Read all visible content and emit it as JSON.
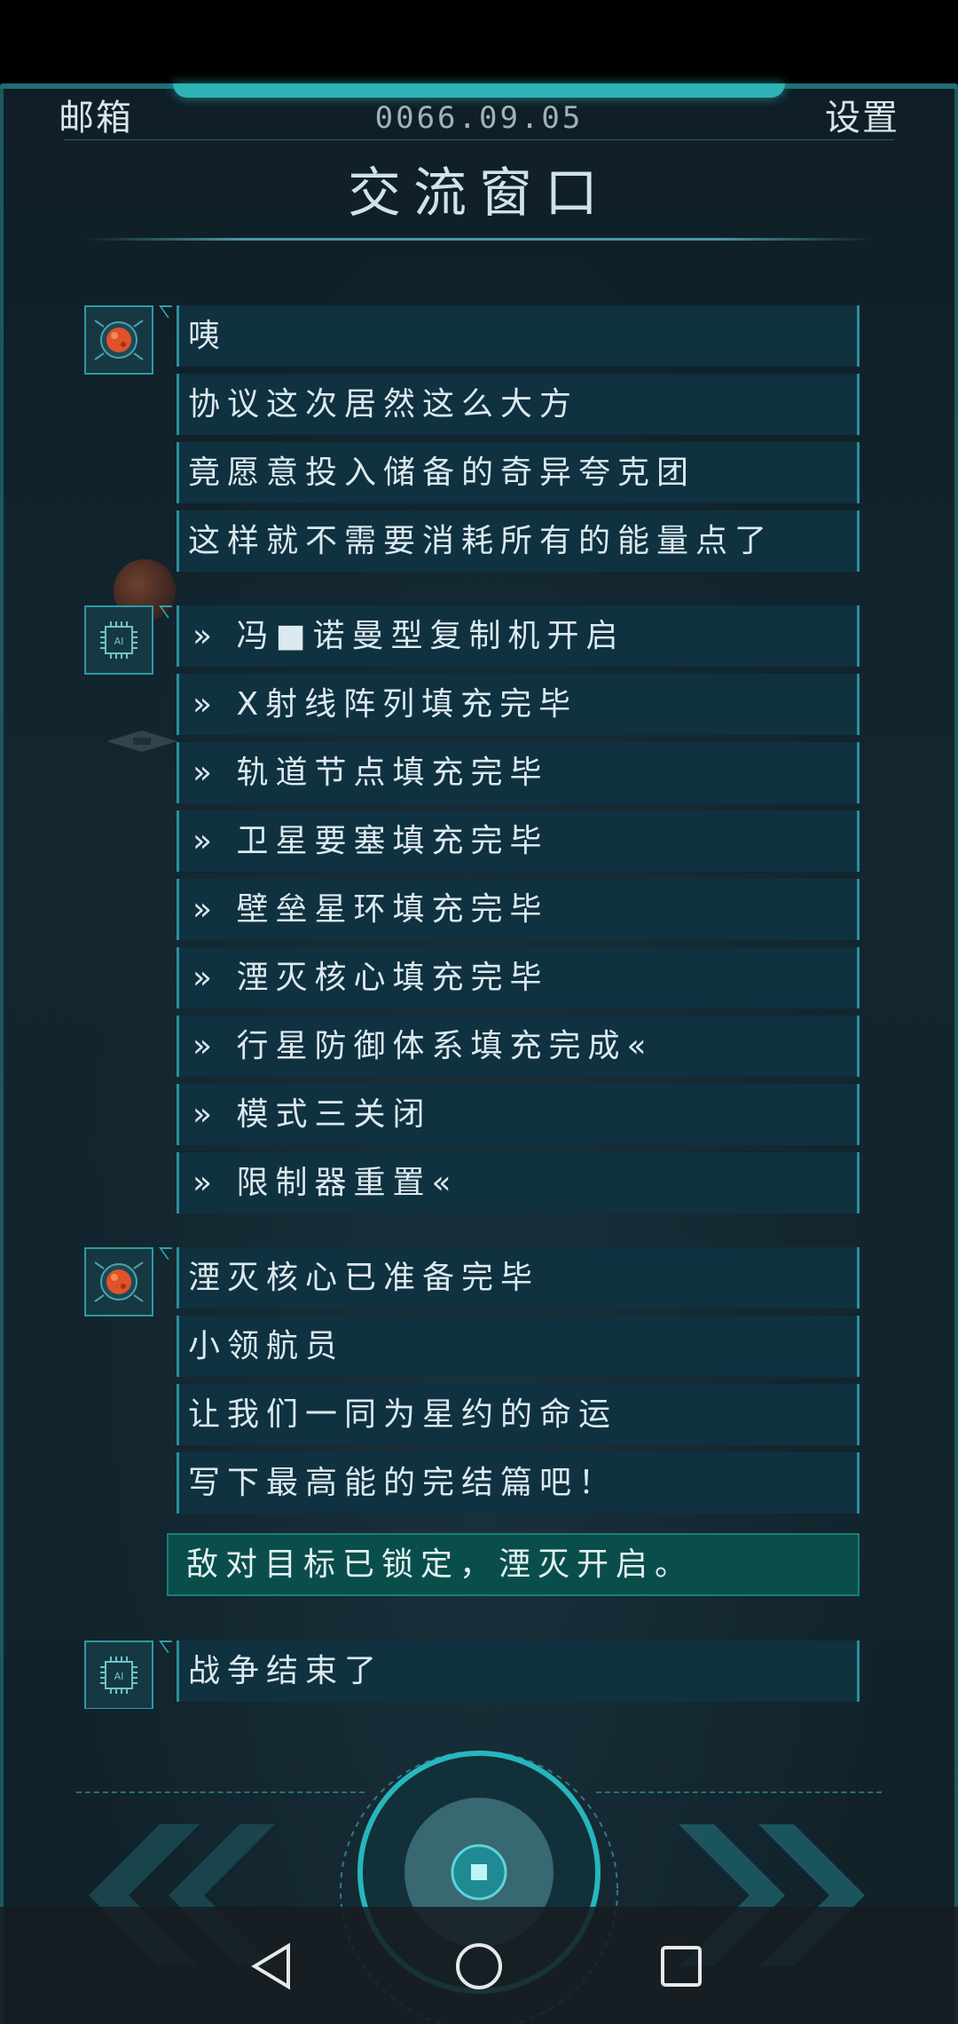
{
  "header": {
    "left_label": "邮箱",
    "date": "0066.09.05",
    "right_label": "设置",
    "title": "交流窗口"
  },
  "chat": {
    "group1": {
      "speaker": "planet-avatar",
      "messages": [
        "咦",
        "协议这次居然这么大方",
        "竟愿意投入储备的奇异夸克团",
        "这样就不需要消耗所有的能量点了"
      ]
    },
    "group2": {
      "speaker": "ai-avatar",
      "avatar_text": "AI",
      "messages": [
        "» 冯■诺曼型复制机开启",
        "» X射线阵列填充完毕",
        "» 轨道节点填充完毕",
        "» 卫星要塞填充完毕",
        "» 壁垒星环填充完毕",
        "» 湮灭核心填充完毕",
        "» 行星防御体系填充完成«",
        "» 模式三关闭",
        "» 限制器重置«"
      ]
    },
    "group3": {
      "speaker": "planet-avatar",
      "messages": [
        "湮灭核心已准备完毕",
        "小领航员",
        "让我们一同为星约的命运",
        "写下最高能的完结篇吧！"
      ]
    },
    "reply_option": "敌对目标已锁定，湮灭开启。",
    "group4": {
      "speaker": "ai-avatar",
      "avatar_text": "AI",
      "messages": [
        "战争结束了"
      ]
    }
  },
  "controls": {
    "prev_icon": "double-chevron-left-icon",
    "next_icon": "double-chevron-right-icon",
    "center_icon": "dial-button-icon"
  },
  "navbar": {
    "back_icon": "triangle-back-icon",
    "home_icon": "circle-home-icon",
    "recents_icon": "square-recents-icon"
  },
  "colors": {
    "accent": "#2eb3b6",
    "bubble": "#0f3140",
    "highlight": "#0a4e4c",
    "background": "#13262f"
  }
}
